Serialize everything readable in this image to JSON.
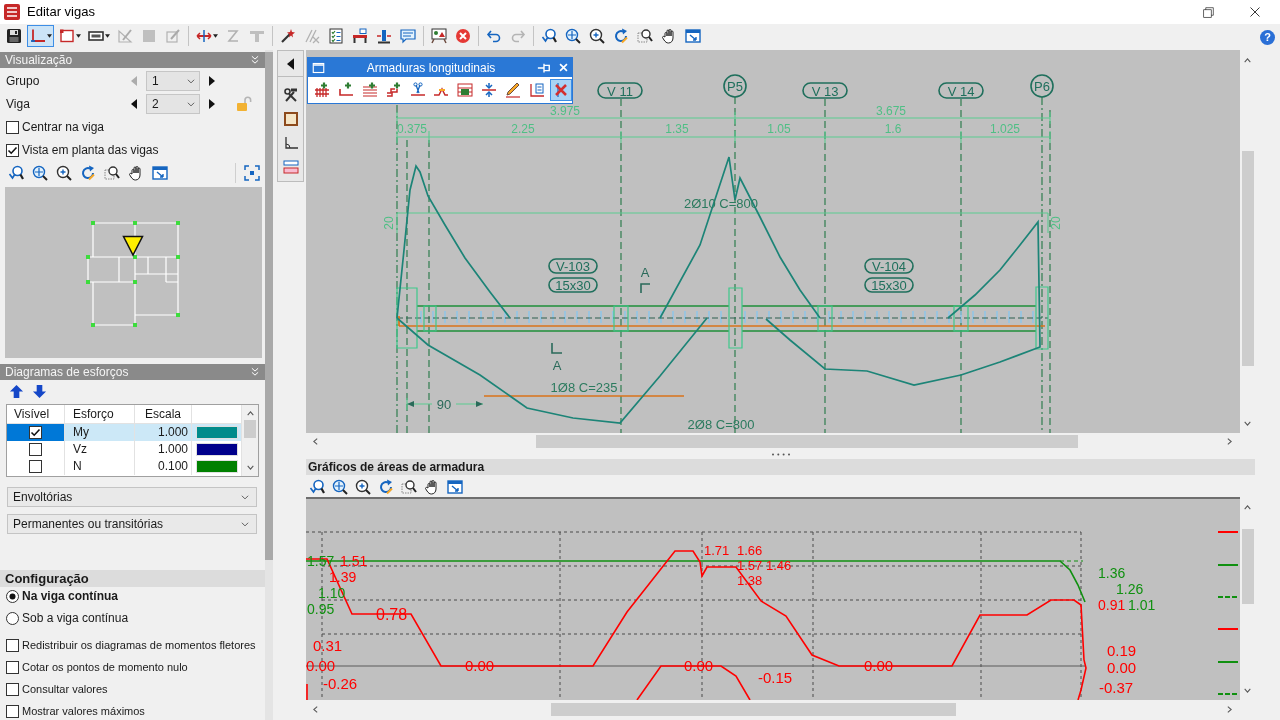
{
  "window": {
    "title": "Editar vigas",
    "help": "?"
  },
  "toolbar": {
    "groups": [
      [
        {
          "kind": "save",
          "selected": false,
          "disabled": false,
          "menu": false
        },
        {
          "kind": "beam-view",
          "selected": true,
          "disabled": false,
          "menu": true
        },
        {
          "kind": "frame",
          "selected": false,
          "disabled": false,
          "menu": true
        },
        {
          "kind": "section",
          "selected": false,
          "disabled": false,
          "menu": true
        },
        {
          "kind": "triangle-pencil",
          "selected": false,
          "disabled": true,
          "menu": false
        },
        {
          "kind": "square",
          "selected": false,
          "disabled": true,
          "menu": false
        },
        {
          "kind": "edit",
          "selected": false,
          "disabled": true,
          "menu": false
        }
      ],
      [
        {
          "kind": "split-arrows",
          "selected": false,
          "disabled": false,
          "menu": true
        },
        {
          "kind": "z-line",
          "selected": false,
          "disabled": true,
          "menu": false
        },
        {
          "kind": "t-beam",
          "selected": false,
          "disabled": true,
          "menu": false
        }
      ],
      [
        {
          "kind": "wand",
          "selected": false,
          "disabled": false,
          "menu": false
        },
        {
          "kind": "strike",
          "selected": false,
          "disabled": true,
          "menu": false
        },
        {
          "kind": "checklist",
          "selected": false,
          "disabled": false,
          "menu": false
        },
        {
          "kind": "beam-supports",
          "selected": false,
          "disabled": false,
          "menu": false
        },
        {
          "kind": "column",
          "selected": false,
          "disabled": false,
          "menu": false
        },
        {
          "kind": "comment",
          "selected": false,
          "disabled": false,
          "menu": false
        }
      ],
      [
        {
          "kind": "board",
          "selected": false,
          "disabled": false,
          "menu": false
        },
        {
          "kind": "cancel",
          "selected": false,
          "disabled": false,
          "menu": false
        }
      ],
      [
        {
          "kind": "undo",
          "selected": false,
          "disabled": false,
          "menu": false
        },
        {
          "kind": "redo",
          "selected": false,
          "disabled": true,
          "menu": false
        }
      ],
      [
        {
          "kind": "zoom-previous",
          "selected": false,
          "disabled": false,
          "menu": false
        },
        {
          "kind": "zoom-extents",
          "selected": false,
          "disabled": false,
          "menu": false
        },
        {
          "kind": "zoom-in",
          "selected": false,
          "disabled": false,
          "menu": false
        },
        {
          "kind": "refresh",
          "selected": false,
          "disabled": false,
          "menu": false
        },
        {
          "kind": "zoom-window",
          "selected": false,
          "disabled": false,
          "menu": false
        },
        {
          "kind": "pan",
          "selected": false,
          "disabled": false,
          "menu": false
        },
        {
          "kind": "new-window",
          "selected": false,
          "disabled": false,
          "menu": false
        }
      ]
    ]
  },
  "visualization": {
    "title": "Visualização",
    "selectors": [
      {
        "label": "Grupo",
        "value": "1",
        "previous_disabled": true
      },
      {
        "label": "Viga",
        "value": "2",
        "previous_disabled": false
      }
    ],
    "lock": {
      "locked": false
    },
    "options": [
      {
        "label": "Centrar na viga",
        "checked": false
      },
      {
        "label": "Vista em planta das vigas",
        "checked": true
      }
    ],
    "tools": [
      {
        "kind": "zoom-previous"
      },
      {
        "kind": "zoom-extents"
      },
      {
        "kind": "zoom-in"
      },
      {
        "kind": "refresh"
      },
      {
        "kind": "zoom-window"
      },
      {
        "kind": "pan"
      },
      {
        "kind": "new-window"
      },
      {
        "kind": "expand"
      }
    ]
  },
  "forces": {
    "title": "Diagramas de esforços",
    "columns": [
      "Visível",
      "Esforço",
      "Escala"
    ],
    "rows": [
      {
        "visible": true,
        "selected": true,
        "effort": "My",
        "scale": "1.000",
        "color": "#008b8b"
      },
      {
        "visible": false,
        "selected": false,
        "effort": "Vz",
        "scale": "1.000",
        "color": "#00008b"
      },
      {
        "visible": false,
        "selected": false,
        "effort": "N",
        "scale": "0.100",
        "color": "#008000"
      }
    ],
    "dropdowns": [
      {
        "value": "Envoltórias"
      },
      {
        "value": "Permanentes ou transitórias"
      }
    ]
  },
  "configuration": {
    "title": "Configuração",
    "placements": [
      {
        "label": "Na viga contínua",
        "selected": true
      },
      {
        "label": "Sob a viga contínua",
        "selected": false
      }
    ],
    "options": [
      {
        "label": "Redistribuir os diagramas de momentos fletores",
        "checked": false
      },
      {
        "label": "Cotar os pontos de momento nulo",
        "checked": false
      },
      {
        "label": "Consultar valores",
        "checked": false
      },
      {
        "label": "Mostrar valores máximos",
        "checked": false
      }
    ]
  },
  "side_tools": [
    {
      "kind": "hammer-wrench"
    },
    {
      "kind": "frame-square"
    },
    {
      "kind": "angle"
    },
    {
      "kind": "beam-layers"
    }
  ],
  "palette": {
    "title": "Armaduras longitudinais",
    "tools": [
      {
        "kind": "grid-plus",
        "selected": false
      },
      {
        "kind": "corner-plus",
        "selected": false
      },
      {
        "kind": "lines-plus",
        "selected": false
      },
      {
        "kind": "steps-plus",
        "selected": false
      },
      {
        "kind": "scissors",
        "selected": false
      },
      {
        "kind": "bend",
        "selected": false
      },
      {
        "kind": "stack",
        "selected": false
      },
      {
        "kind": "converge",
        "selected": false
      },
      {
        "kind": "pencil",
        "selected": false
      },
      {
        "kind": "chart-list",
        "selected": false
      },
      {
        "kind": "x-mark",
        "selected": true
      }
    ]
  },
  "beam_drawing": {
    "axes": [
      {
        "kind": "beam",
        "label": "V 11"
      },
      {
        "kind": "column",
        "label": "P5"
      },
      {
        "kind": "beam",
        "label": "V 13"
      },
      {
        "kind": "beam",
        "label": "V 14"
      },
      {
        "kind": "column",
        "label": "P6"
      }
    ],
    "totals": [
      "3.975",
      "3.675"
    ],
    "spans": [
      "0.375",
      "2.25",
      "1.35",
      "1.05",
      "1.6",
      "1.025"
    ],
    "heights": [
      "20",
      "20"
    ],
    "beams": [
      {
        "name": "V-103",
        "section": "15x30"
      },
      {
        "name": "V-104",
        "section": "15x30"
      }
    ],
    "section_marks": [
      "A",
      "A"
    ],
    "rebars": [
      "2Ø10 C=800",
      "1Ø8 C=235",
      "2Ø8 C=800"
    ],
    "anchorage": "90"
  },
  "area_chart": {
    "title": "Gráficos de áreas de armadura",
    "tools": [
      {
        "kind": "zoom-previous"
      },
      {
        "kind": "zoom-extents"
      },
      {
        "kind": "zoom-in"
      },
      {
        "kind": "refresh"
      },
      {
        "kind": "zoom-window"
      },
      {
        "kind": "pan"
      },
      {
        "kind": "new-window"
      }
    ],
    "labels": [
      {
        "text": "1.57",
        "color": "#109010"
      },
      {
        "text": "1.51",
        "color": "#ff0000"
      },
      {
        "text": "1.39",
        "color": "#ff0000"
      },
      {
        "text": "1.10",
        "color": "#109010"
      },
      {
        "text": "0.95",
        "color": "#109010"
      },
      {
        "text": "0.78",
        "color": "#ff0000"
      },
      {
        "text": "0.31",
        "color": "#ff0000"
      },
      {
        "text": "0.00",
        "color": "#ff0000"
      },
      {
        "text": "-0.26",
        "color": "#ff0000"
      },
      {
        "text": "0.00",
        "color": "#ff0000"
      },
      {
        "text": "1.71",
        "color": "#ff0000"
      },
      {
        "text": "1.66",
        "color": "#ff0000"
      },
      {
        "text": "1.57",
        "color": "#ff0000"
      },
      {
        "text": "1.46",
        "color": "#ff0000"
      },
      {
        "text": "1.38",
        "color": "#ff0000"
      },
      {
        "text": "0.00",
        "color": "#ff0000"
      },
      {
        "text": "-0.15",
        "color": "#ff0000"
      },
      {
        "text": "0.00",
        "color": "#ff0000"
      },
      {
        "text": "1.36",
        "color": "#109010"
      },
      {
        "text": "1.26",
        "color": "#109010"
      },
      {
        "text": "0.91",
        "color": "#ff0000"
      },
      {
        "text": "1.01",
        "color": "#109010"
      },
      {
        "text": "0.19",
        "color": "#ff0000"
      },
      {
        "text": "0.00",
        "color": "#ff0000"
      },
      {
        "text": "-0.37",
        "color": "#ff0000"
      }
    ],
    "legend": [
      {
        "color": "#ff0000",
        "dashed": false
      },
      {
        "color": "#109010",
        "dashed": false
      },
      {
        "color": "#109010",
        "dashed": true
      },
      {
        "color": "#ff0000",
        "dashed": false
      },
      {
        "color": "#109010",
        "dashed": false
      },
      {
        "color": "#109010",
        "dashed": true
      }
    ]
  }
}
